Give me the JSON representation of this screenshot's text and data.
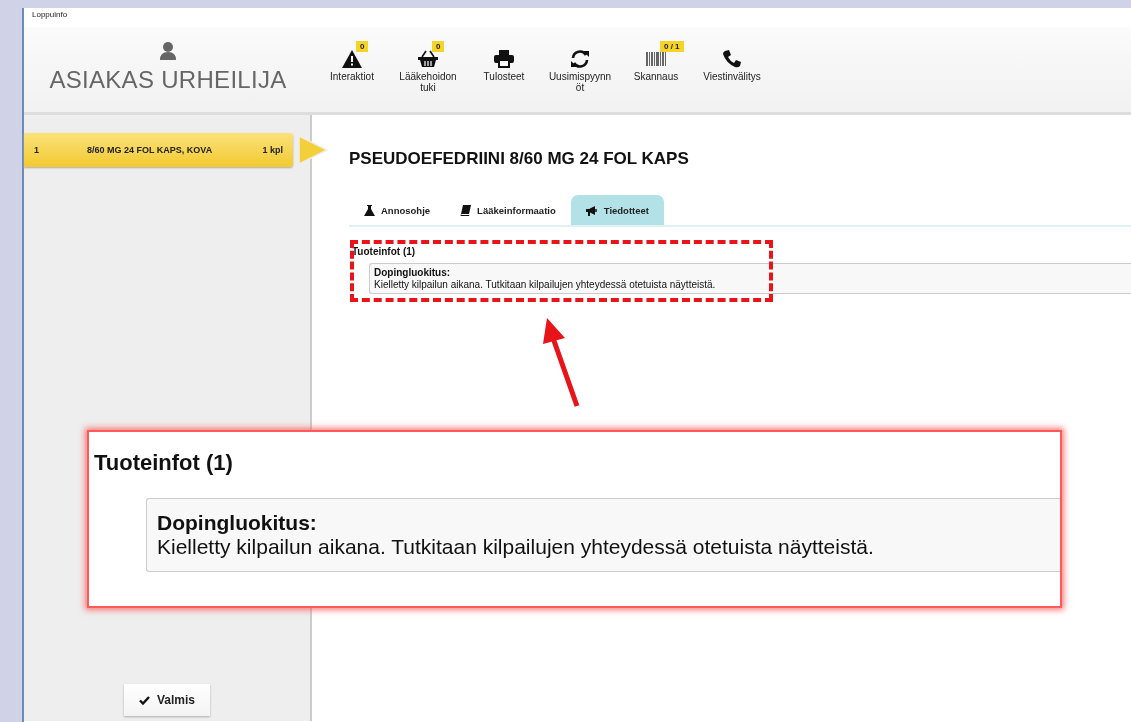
{
  "window": {
    "title": "Loppuinfo"
  },
  "customer": {
    "name": "ASIAKAS URHEILIJA"
  },
  "toolbar": [
    {
      "label": "Interaktiot",
      "badge": "0"
    },
    {
      "label": "Lääkehoidon tuki",
      "badge": "0"
    },
    {
      "label": "Tulosteet"
    },
    {
      "label": "Uusimispyynnöt"
    },
    {
      "label": "Skannaus",
      "badge": "0 / 1"
    },
    {
      "label": "Viestinvälitys"
    }
  ],
  "order": {
    "items": [
      {
        "number": "1",
        "name": "8/60 MG 24 FOL KAPS, KOVA",
        "quantity": "1 kpl",
        "selected": true
      }
    ]
  },
  "product": {
    "title": "PSEUDOEFEDRIINI 8/60 MG 24 FOL KAPS"
  },
  "tabs": [
    {
      "label": "Annosohje",
      "selected": false
    },
    {
      "label": "Lääkeinformaatio",
      "selected": false
    },
    {
      "label": "Tiedotteet",
      "selected": true
    }
  ],
  "section": {
    "heading": "Tuoteinfot (1)",
    "notices": [
      {
        "title": "Dopingluokitus:",
        "text": "Kielletty kilpailun aikana. Tutkitaan kilpailujen yhteydessä otetuista näytteistä."
      }
    ]
  },
  "callout": {
    "heading": "Tuoteinfot (1)",
    "notices": [
      {
        "title": "Dopingluokitus:",
        "text": "Kielletty kilpailun aikana. Tutkitaan kilpailujen yhteydessä otetuista näytteistä."
      }
    ]
  },
  "footer": {
    "button": "Valmis"
  }
}
